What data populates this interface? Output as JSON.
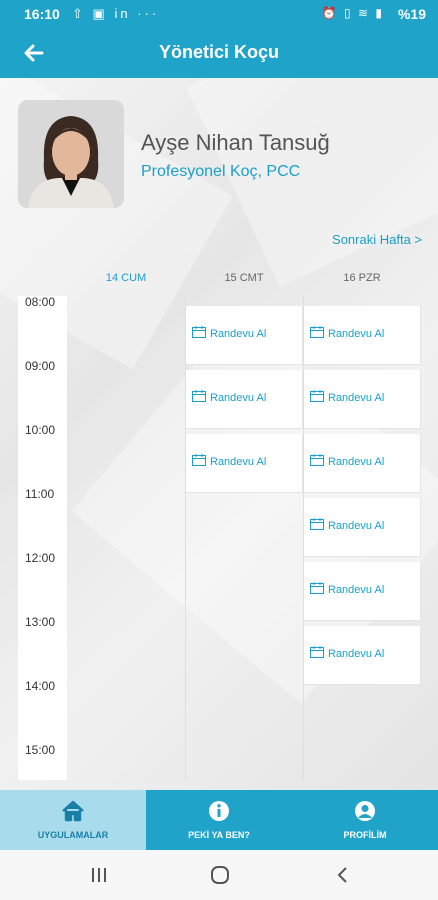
{
  "status_bar": {
    "time": "16:10",
    "left_icons": [
      "upload-icon",
      "image-icon",
      "linkedin-icon",
      "more-icon"
    ],
    "right_icons": [
      "alarm-icon",
      "vibrate-icon",
      "wifi-icon",
      "signal-icon"
    ],
    "battery": "%19"
  },
  "app_bar": {
    "title": "Yönetici Koçu",
    "back_icon": "arrow-left-icon"
  },
  "profile": {
    "name": "Ayşe Nihan Tansuğ",
    "role": "Profesyonel Koç, PCC"
  },
  "next_week_label": "Sonraki Hafta >",
  "days": [
    {
      "label": "14 CUM",
      "active": true
    },
    {
      "label": "15 CMT",
      "active": false
    },
    {
      "label": "16 PZR",
      "active": false
    }
  ],
  "times": [
    "08:00",
    "09:00",
    "10:00",
    "11:00",
    "12:00",
    "13:00",
    "14:00",
    "15:00"
  ],
  "slot_label": "Randevu Al",
  "slots": {
    "day2": [
      "08:00",
      "09:00",
      "10:00"
    ],
    "day3": [
      "08:00",
      "09:00",
      "10:00",
      "11:00",
      "12:00",
      "13:00"
    ]
  },
  "bottom_nav": [
    {
      "label": "UYGULAMALAR",
      "icon": "home-icon",
      "active": true
    },
    {
      "label": "PEKİ YA BEN?",
      "icon": "info-icon",
      "active": false
    },
    {
      "label": "PROFİLİM",
      "icon": "user-icon",
      "active": false
    }
  ],
  "system_nav": [
    "recents-icon",
    "home-circle-icon",
    "back-chevron-icon"
  ],
  "colors": {
    "primary": "#1fa3c8",
    "accent_text": "#1a9fc9",
    "nav_active": "#a8dcec"
  }
}
